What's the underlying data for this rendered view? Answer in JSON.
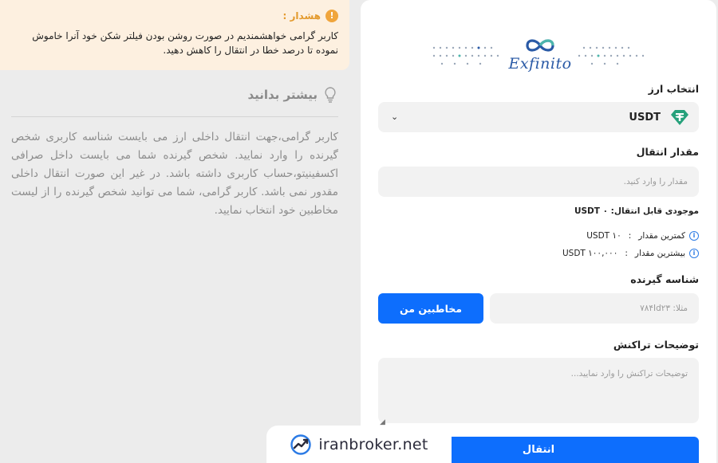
{
  "warning": {
    "title": "هشدار :",
    "text": "کاربر گرامی خواهشمندیم در صورت روشن بودن فیلتر شکن خود آنرا خاموش نموده تا درصد خطا در انتقال را کاهش دهید."
  },
  "learn_more": {
    "title": "بیشتر بدانید",
    "text": "کاربر گرامی،جهت انتقال داخلی ارز می بایست شناسه کاربری شخص گیرنده را وارد نمایید. شخص گیرنده شما می بایست داخل صرافی اکسفینیتو،حساب کاربری داشته باشد. در غیر این صورت انتقال داخلی مقدور نمی باشد. کاربر گرامی، شما می توانید شخص گیرنده را از لیست مخاطبین خود انتخاب نمایید."
  },
  "brand": {
    "name": "Exfinito",
    "color": "#2a5aa6"
  },
  "form": {
    "currency_label": "انتخاب ارز",
    "currency_value": "USDT",
    "currency_icon": "tether-icon",
    "amount_label": "مقدار انتقال",
    "amount_placeholder": "مقدار را وارد کنید.",
    "available_balance": "موجودی قابل انتقال: ۰ USDT",
    "min_label": "کمترین مقدار",
    "min_value": "USDT ۱۰",
    "max_label": "بیشترین مقدار",
    "max_value": "USDT ۱۰۰,۰۰۰",
    "limit_separator": ":",
    "receiver_label": "شناسه گیرنده",
    "receiver_placeholder": "مثلا: ۷۸۴Id۲۳",
    "contacts_button": "مخاطبین من",
    "description_label": "توضیحات تراکنش",
    "description_placeholder": "توضیحات تراکنش را وارد نمایید...",
    "submit_button": "انتقال"
  },
  "watermark": {
    "text": "iranbroker.net"
  },
  "colors": {
    "primary": "#0d6efd",
    "warning_bg": "#fdf0e0",
    "warning_accent": "#f0a53c"
  }
}
